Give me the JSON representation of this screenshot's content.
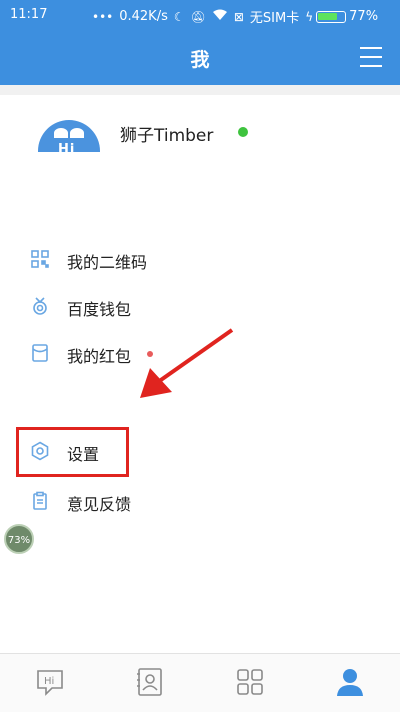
{
  "status_bar": {
    "time": "11:17",
    "net_speed": "0.42K/s",
    "carrier": "无SIM卡",
    "battery": "77%",
    "battery_level": 0.77
  },
  "header": {
    "title": "我",
    "menu_icon": "hamburger-menu-icon"
  },
  "profile": {
    "name": "狮子Timber",
    "avatar_text": "Hi",
    "online_color": "#3ec33e"
  },
  "menu": {
    "items": [
      {
        "label": "我的二维码",
        "icon": "qrcode-icon"
      },
      {
        "label": "百度钱包",
        "icon": "wallet-icon"
      },
      {
        "label": "我的红包",
        "icon": "red-packet-icon",
        "has_dot": true
      },
      {
        "label": "设置",
        "icon": "gear-icon",
        "highlighted": true
      },
      {
        "label": "意见反馈",
        "icon": "feedback-icon"
      }
    ]
  },
  "floating_badge": "73%",
  "tabbar": {
    "tabs": [
      {
        "name": "chat",
        "icon": "hi-chat-icon",
        "label": "Hi"
      },
      {
        "name": "contacts",
        "icon": "contacts-icon"
      },
      {
        "name": "apps",
        "icon": "grid-icon"
      },
      {
        "name": "me",
        "icon": "user-icon",
        "active": true
      }
    ]
  },
  "colors": {
    "brand": "#3d8fdf",
    "accent_icon": "#6aa7e3",
    "highlight_box": "#e0241f",
    "arrow": "#e0241f"
  }
}
